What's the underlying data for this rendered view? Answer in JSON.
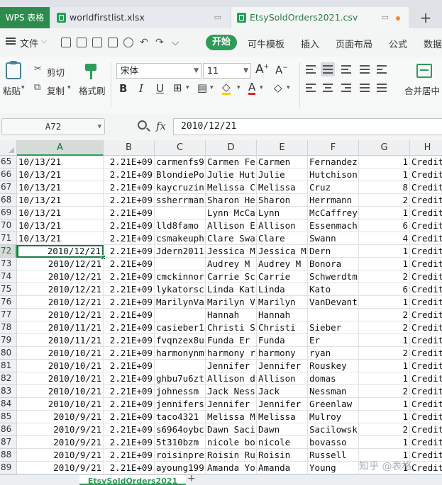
{
  "tabs": {
    "app": "WPS 表格",
    "files": [
      {
        "label": "worldfirstlist.xlsx"
      },
      {
        "label": "EtsySoldOrders2021.csv"
      }
    ],
    "add": "+"
  },
  "menu": {
    "file": "文件",
    "start": "开始",
    "items": [
      "可牛模板",
      "插入",
      "页面布局",
      "公式",
      "数据"
    ]
  },
  "ribbon": {
    "paste": "粘贴",
    "cut": "剪切",
    "copy": "复制",
    "format_painter": "格式刷",
    "font_name": "宋体",
    "font_size": "11",
    "merge": "合并居中"
  },
  "formula_bar": {
    "name_box": "A72",
    "fx": "fx",
    "value": "2010/12/21"
  },
  "columns": [
    "A",
    "B",
    "C",
    "D",
    "E",
    "F",
    "G",
    "H"
  ],
  "rows": [
    {
      "n": "65",
      "a": "10/13/21",
      "b": "2.21E+09",
      "c": "carmenfs9",
      "d": "Carmen Fe",
      "e": "Carmen",
      "f": "Fernandez",
      "g": "1",
      "h": "Credit"
    },
    {
      "n": "66",
      "a": "10/13/21",
      "b": "2.21E+09",
      "c": "BlondiePo",
      "d": "Julie Hut",
      "e": "Julie",
      "f": "Hutchison",
      "g": "1",
      "h": "Credit"
    },
    {
      "n": "67",
      "a": "10/13/21",
      "b": "2.21E+09",
      "c": "kaycruzin",
      "d": "Melissa C",
      "e": "Melissa",
      "f": "Cruz",
      "g": "8",
      "h": "Credit"
    },
    {
      "n": "68",
      "a": "10/13/21",
      "b": "2.21E+09",
      "c": "ssherrman",
      "d": "Sharon He",
      "e": "Sharon",
      "f": "Herrmann",
      "g": "2",
      "h": "Credit"
    },
    {
      "n": "69",
      "a": "10/13/21",
      "b": "2.21E+09",
      "c": "",
      "d": "Lynn McCa",
      "e": "Lynn",
      "f": "McCaffrey",
      "g": "1",
      "h": "Credit"
    },
    {
      "n": "70",
      "a": "10/13/21",
      "b": "2.21E+09",
      "c": "lld8famo",
      "d": "Allison E",
      "e": "Allison",
      "f": "Essenmach",
      "g": "6",
      "h": "Credit"
    },
    {
      "n": "71",
      "a": "10/13/21",
      "b": "2.21E+09",
      "c": "csmakeuph",
      "d": "Clare Swa",
      "e": "Clare",
      "f": "Swann",
      "g": "4",
      "h": "Credit"
    },
    {
      "n": "72",
      "a": "2010/12/21",
      "b": "2.21E+09",
      "c": "Jdern2011",
      "d": "Jessica M",
      "e": "Jessica M",
      "f": "Dern",
      "g": "1",
      "h": "Credit"
    },
    {
      "n": "73",
      "a": "2010/12/21",
      "b": "2.21E+09",
      "c": "",
      "d": "Audrey M",
      "e": "Audrey M",
      "f": "Bonora",
      "g": "1",
      "h": "Credit"
    },
    {
      "n": "74",
      "a": "2010/12/21",
      "b": "2.21E+09",
      "c": "cmckinnor",
      "d": "Carrie Sc",
      "e": "Carrie",
      "f": "Schwerdtm",
      "g": "2",
      "h": "Credit"
    },
    {
      "n": "75",
      "a": "2010/12/21",
      "b": "2.21E+09",
      "c": "lykatorsc",
      "d": "Linda Kat",
      "e": "Linda",
      "f": "Kato",
      "g": "6",
      "h": "Credit"
    },
    {
      "n": "76",
      "a": "2010/12/21",
      "b": "2.21E+09",
      "c": "MarilynVa",
      "d": "Marilyn V",
      "e": "Marilyn",
      "f": "VanDevant",
      "g": "1",
      "h": "Credit"
    },
    {
      "n": "77",
      "a": "2010/12/21",
      "b": "2.21E+09",
      "c": "",
      "d": "Hannah",
      "e": "Hannah",
      "f": "",
      "g": "2",
      "h": "Credit"
    },
    {
      "n": "78",
      "a": "2010/11/21",
      "b": "2.21E+09",
      "c": "casieber1",
      "d": "Christi S",
      "e": "Christi",
      "f": "Sieber",
      "g": "2",
      "h": "Credit"
    },
    {
      "n": "79",
      "a": "2010/11/21",
      "b": "2.21E+09",
      "c": "fvqnzex8u",
      "d": "Funda Er",
      "e": "Funda",
      "f": "Er",
      "g": "1",
      "h": "Credit"
    },
    {
      "n": "80",
      "a": "2010/10/21",
      "b": "2.21E+09",
      "c": "harmonynm",
      "d": "harmony r",
      "e": "harmony",
      "f": "ryan",
      "g": "2",
      "h": "Credit"
    },
    {
      "n": "81",
      "a": "2010/10/21",
      "b": "2.21E+09",
      "c": "",
      "d": "Jennifer",
      "e": "Jennifer",
      "f": "Rouskey",
      "g": "1",
      "h": "Credit"
    },
    {
      "n": "82",
      "a": "2010/10/21",
      "b": "2.21E+09",
      "c": "ghbu7u6zt",
      "d": "Allison d",
      "e": "Allison",
      "f": "domas",
      "g": "1",
      "h": "Credit"
    },
    {
      "n": "83",
      "a": "2010/10/21",
      "b": "2.21E+09",
      "c": "johnessm",
      "d": "Jack Ness",
      "e": "Jack",
      "f": "Nessman",
      "g": "2",
      "h": "Credit"
    },
    {
      "n": "84",
      "a": "2010/10/21",
      "b": "2.21E+09",
      "c": "jennifers",
      "d": "Jennifer",
      "e": "Jennifer",
      "f": "Greenlaw",
      "g": "1",
      "h": "Credit"
    },
    {
      "n": "85",
      "a": "2010/9/21",
      "b": "2.21E+09",
      "c": "taco4321",
      "d": "Melissa M",
      "e": "Melissa",
      "f": "Mulroy",
      "g": "1",
      "h": "Credit"
    },
    {
      "n": "86",
      "a": "2010/9/21",
      "b": "2.21E+09",
      "c": "s6964oybc",
      "d": "Dawn Saci",
      "e": "Dawn",
      "f": "Sacilowsk",
      "g": "2",
      "h": "Credit"
    },
    {
      "n": "87",
      "a": "2010/9/21",
      "b": "2.21E+09",
      "c": "5t310bzm",
      "d": "nicole bo",
      "e": "nicole",
      "f": "bovasso",
      "g": "1",
      "h": "Credit"
    },
    {
      "n": "88",
      "a": "2010/9/21",
      "b": "2.21E+09",
      "c": "roisinpre",
      "d": "Roisin Ru",
      "e": "Roisin",
      "f": "Russell",
      "g": "1",
      "h": "Credit"
    },
    {
      "n": "89",
      "a": "2010/9/21",
      "b": "2.21E+09",
      "c": "ayoung199",
      "d": "Amanda Yo",
      "e": "Amanda",
      "f": "Young",
      "g": "1",
      "h": "Credit"
    }
  ],
  "sheet_tab": "EtsySoldOrders2021",
  "watermark": "知乎 @表格"
}
